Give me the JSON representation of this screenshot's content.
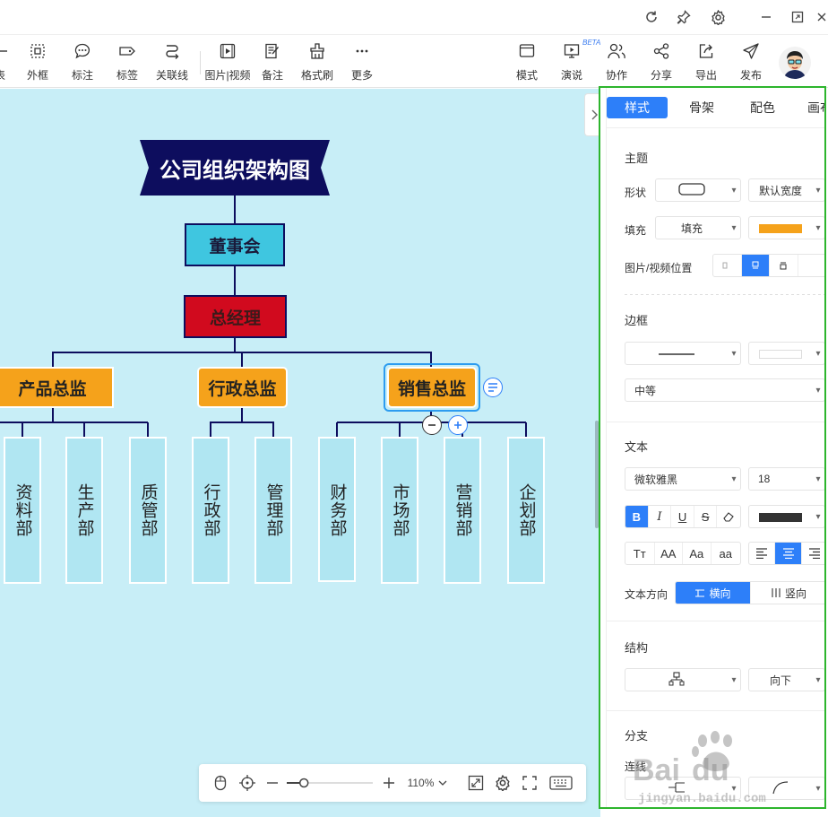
{
  "toolbar": {
    "items": [
      {
        "label": "表"
      },
      {
        "label": "外框"
      },
      {
        "label": "标注"
      },
      {
        "label": "标签"
      },
      {
        "label": "关联线"
      },
      {
        "label": "图片|视频"
      },
      {
        "label": "备注"
      },
      {
        "label": "格式刷"
      },
      {
        "label": "更多"
      }
    ],
    "right_items": [
      {
        "label": "模式"
      },
      {
        "label": "演说",
        "badge": "BETA"
      },
      {
        "label": "协作"
      },
      {
        "label": "分享"
      },
      {
        "label": "导出"
      },
      {
        "label": "发布"
      }
    ]
  },
  "mindmap": {
    "title": "公司组织架构图",
    "board": "董事会",
    "gm": "总经理",
    "directors": [
      "产品总监",
      "行政总监",
      "销售总监"
    ],
    "departments": {
      "product": [
        "资料部",
        "生产部",
        "质管部"
      ],
      "admin": [
        "行政部",
        "管理部"
      ],
      "sales": [
        "财务部",
        "市场部",
        "营销部",
        "企划部"
      ]
    },
    "colors": {
      "canvas": "#c8eef7",
      "title_bg": "#0d0d5e",
      "board_bg": "#3fc6e0",
      "gm_bg": "#d10a1e",
      "director_bg": "#f5a21b",
      "dept_bg": "#b0e6f2",
      "line": "#0d0d5e",
      "selection": "#2d9cf0"
    }
  },
  "zoom": {
    "level": "110%",
    "slider": 0.2
  },
  "panel": {
    "tabs": [
      "样式",
      "骨架",
      "配色",
      "画布"
    ],
    "active_tab": 0,
    "theme": {
      "title": "主题",
      "shape_label": "形状",
      "width_value": "默认宽度",
      "fill_label": "填充",
      "fill_value": "填充",
      "fill_color": "#f5a21b",
      "media_label": "图片/视频位置"
    },
    "border": {
      "title": "边框",
      "weight_value": "中等"
    },
    "text": {
      "title": "文本",
      "font_value": "微软雅黑",
      "size_value": "18",
      "text_color": "#333333",
      "case_options": [
        "Tт",
        "AA",
        "Aa",
        "aa"
      ],
      "direction_label": "文本方向",
      "direction_options": [
        "横向",
        "竖向"
      ]
    },
    "structure": {
      "title": "结构",
      "direction_value": "向下"
    },
    "branch": {
      "title": "分支",
      "line_label": "连线"
    }
  }
}
